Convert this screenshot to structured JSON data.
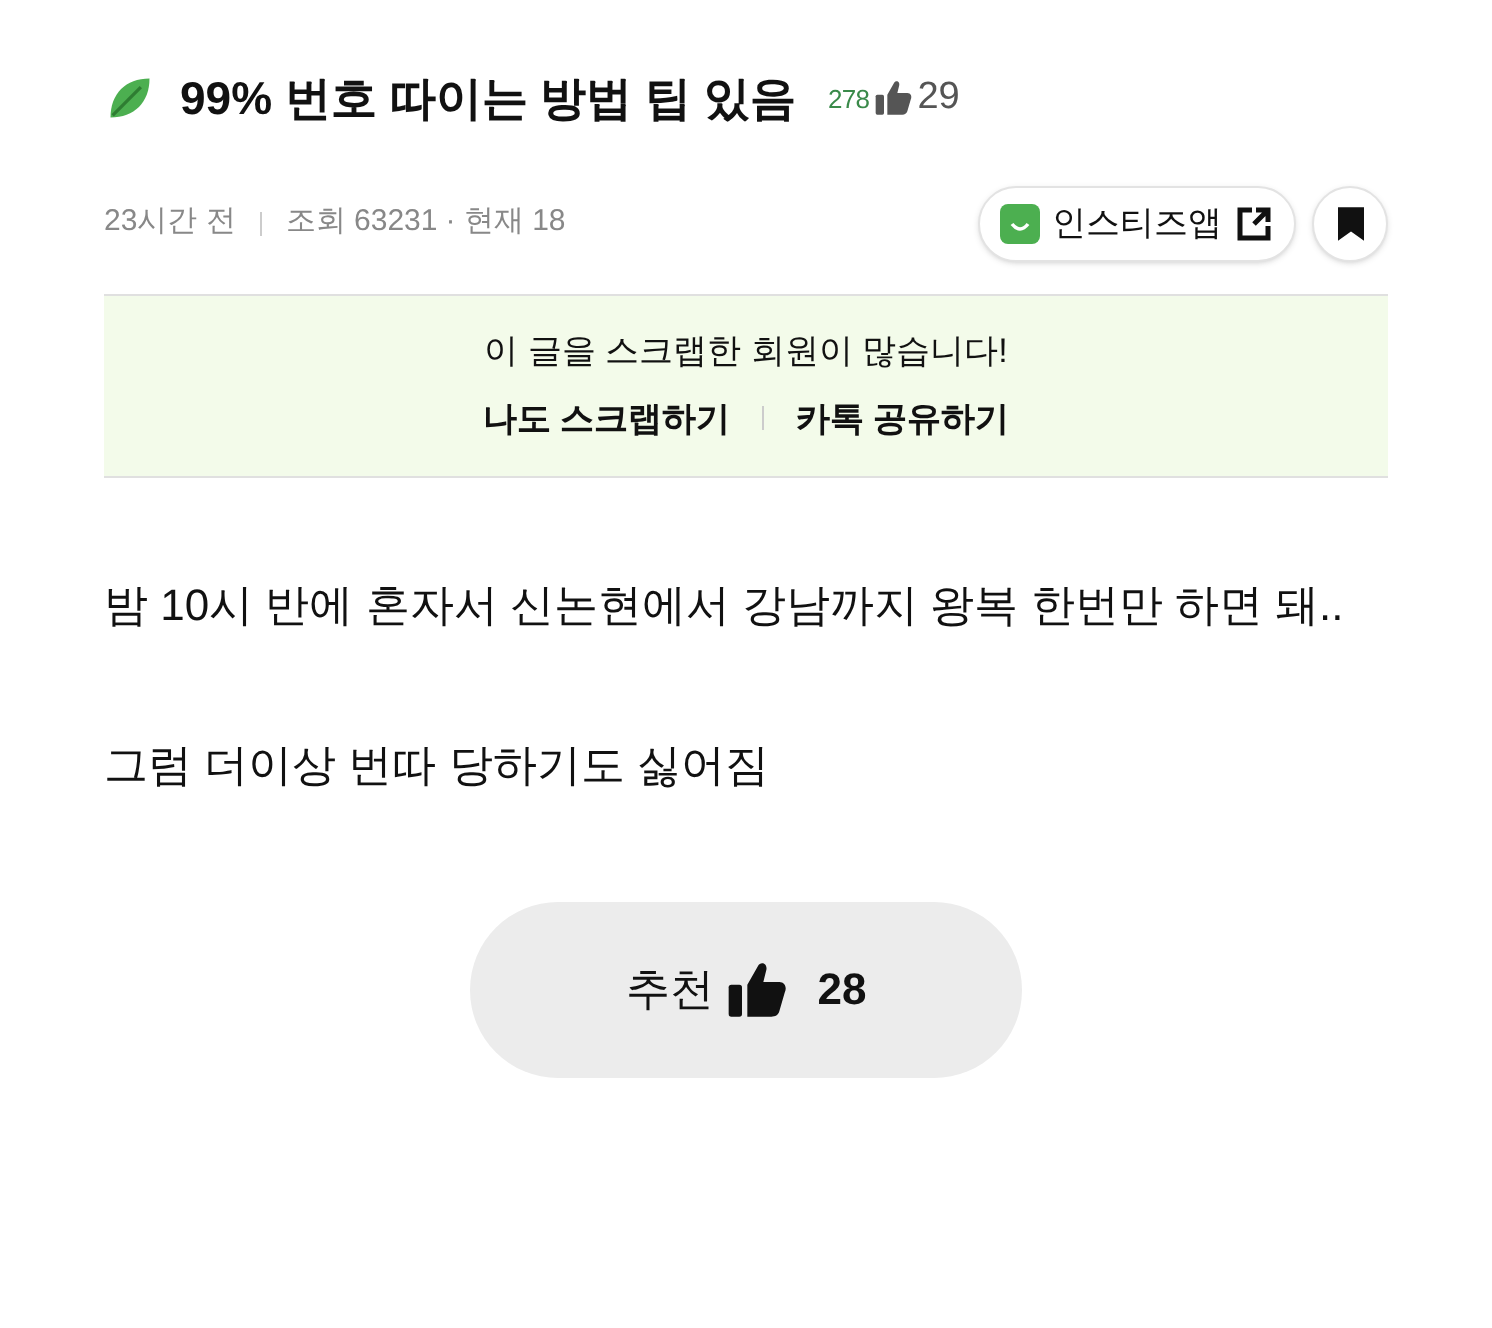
{
  "post": {
    "title": "99% 번호 따이는 방법 팁 있음",
    "comment_count": "278",
    "like_count": "29",
    "time": "23시간 전",
    "views": "조회 63231",
    "current": "· 현재 18",
    "app_button": "인스티즈앱"
  },
  "scrap_notice": {
    "message": "이 글을 스크랩한 회원이 많습니다!",
    "actions": [
      "나도 스크랩하기",
      "카톡 공유하기"
    ]
  },
  "body": [
    "밤 10시 반에 혼자서 신논현에서 강남까지 왕복 한번만 하면 돼..",
    "그럼 더이상 번따 당하기도 싫어짐"
  ],
  "recommend": {
    "label": "추천",
    "count": "28"
  }
}
